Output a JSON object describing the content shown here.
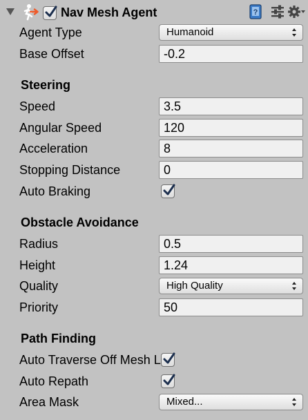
{
  "component": {
    "title": "Nav Mesh Agent",
    "enabled": true
  },
  "agent": {
    "type_label": "Agent Type",
    "type_value": "Humanoid",
    "base_offset_label": "Base Offset",
    "base_offset_value": "-0.2"
  },
  "steering": {
    "heading": "Steering",
    "speed_label": "Speed",
    "speed_value": "3.5",
    "angular_speed_label": "Angular Speed",
    "angular_speed_value": "120",
    "acceleration_label": "Acceleration",
    "acceleration_value": "8",
    "stopping_distance_label": "Stopping Distance",
    "stopping_distance_value": "0",
    "auto_braking_label": "Auto Braking",
    "auto_braking_checked": true
  },
  "obstacle_avoidance": {
    "heading": "Obstacle Avoidance",
    "radius_label": "Radius",
    "radius_value": "0.5",
    "height_label": "Height",
    "height_value": "1.24",
    "quality_label": "Quality",
    "quality_value": "High Quality",
    "priority_label": "Priority",
    "priority_value": "50"
  },
  "path_finding": {
    "heading": "Path Finding",
    "auto_traverse_label": "Auto Traverse Off Mesh Link",
    "auto_traverse_checked": true,
    "auto_repath_label": "Auto Repath",
    "auto_repath_checked": true,
    "area_mask_label": "Area Mask",
    "area_mask_value": "Mixed..."
  },
  "icons": {
    "foldout": "foldout-arrow-icon",
    "component": "nav-mesh-agent-icon",
    "help": "help-book-icon",
    "presets": "presets-sliders-icon",
    "settings": "gear-icon"
  },
  "colors": {
    "panel_background": "#c2c2c2",
    "field_background": "#f0f0f0",
    "checkmark": "#1c2f4e",
    "agent_icon_accent": "#ef5a2a"
  }
}
